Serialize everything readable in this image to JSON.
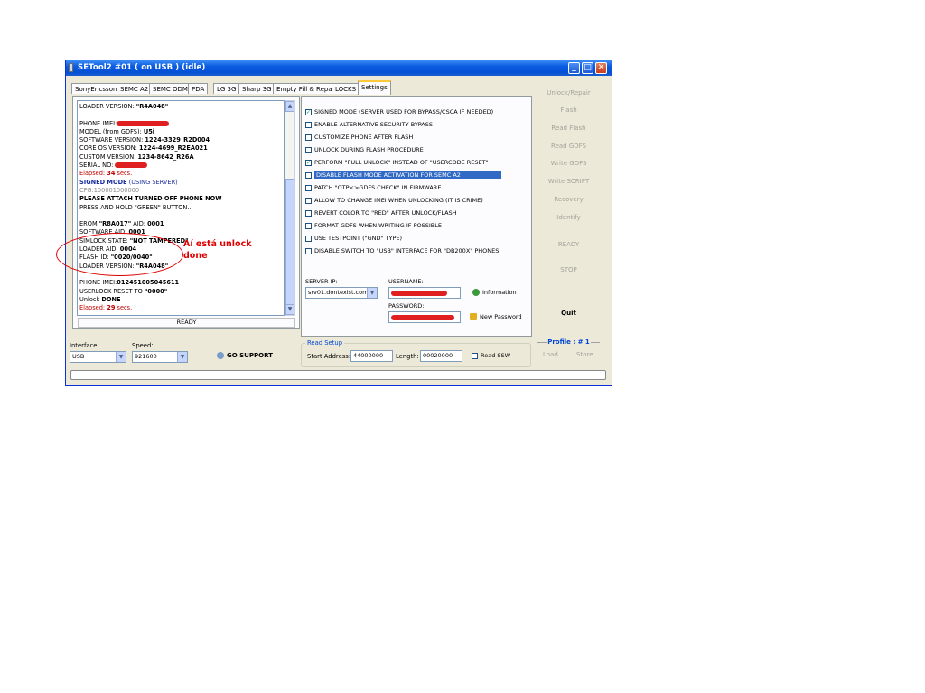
{
  "window": {
    "title": "SETool2 #01 ( on USB ) (idle)",
    "min": "_",
    "max": "□",
    "close": "✕"
  },
  "tabs": [
    {
      "label": "SonyEricsson"
    },
    {
      "label": "SEMC A2"
    },
    {
      "label": "SEMC ODM"
    },
    {
      "label": "PDA"
    },
    {
      "label": "LG 3G"
    },
    {
      "label": "Sharp 3G"
    },
    {
      "label": "Empty Fill & Repair"
    },
    {
      "label": "LOCKS"
    },
    {
      "label": "Settings",
      "active": true
    }
  ],
  "log": {
    "l01": "LOADER VERSION: ",
    "l01b": "\"R4A048\"",
    "l02": "PHONE IMEI:",
    "l03a": "MODEL (from GDFS): ",
    "l03b": "U5i",
    "l04a": "SOFTWARE VERSION: ",
    "l04b": "1224-3329_R2D004",
    "l05a": "CORE OS VERSION: ",
    "l05b": "1224-4699_R2EA021",
    "l06a": "CUSTOM VERSION: ",
    "l06b": "1234-8642_R26A",
    "l07": "SERIAL NO: ",
    "l08a": "Elapsed: ",
    "l08b": "34",
    "l08c": " secs.",
    "l09a": "SIGNED MODE",
    "l09b": " (USING SERVER)",
    "l10": "CFG:100001000000",
    "l11": "PLEASE ATTACH TURNED OFF PHONE NOW",
    "l12": "PRESS AND HOLD \"GREEN\" BUTTON...",
    "l13a": "EROM ",
    "l13b": "\"R8A017\"",
    "l13c": " AID: ",
    "l13d": "0001",
    "l14a": "SOFTWARE AID: ",
    "l14b": "0001",
    "l15a": "SIMLOCK STATE: ",
    "l15b": "\"NOT TAMPERED\"",
    "l16a": "LOADER AID: ",
    "l16b": "0004",
    "l17a": "FLASH ID: ",
    "l17b": "\"0020/0040\"",
    "l18a": "LOADER VERSION: ",
    "l18b": "\"R4A048\"",
    "l19a": "PHONE IMEI:",
    "l19b": "012451005045611",
    "l20a": "USERLOCK RESET TO ",
    "l20b": "\"0000\"",
    "l21a": "Unlock ",
    "l21b": "DONE",
    "l22a": "Elapsed: ",
    "l22b": "29",
    "l22c": " secs."
  },
  "status": "READY",
  "annotation": {
    "line1": "Aí está unlock",
    "line2": "done"
  },
  "settings": {
    "options": [
      {
        "label": "SIGNED MODE (SERVER USED FOR BYPASS/CSCA IF NEEDED)",
        "checked": true
      },
      {
        "label": "ENABLE ALTERNATIVE SECURITY BYPASS",
        "checked": false
      },
      {
        "label": "CUSTOMIZE PHONE AFTER FLASH",
        "checked": false
      },
      {
        "label": "UNLOCK DURING FLASH PROCEDURE",
        "checked": false
      },
      {
        "label": "PERFORM \"FULL UNLOCK\" INSTEAD OF \"USERCODE RESET\"",
        "checked": true
      },
      {
        "label": "DISABLE FLASH MODE ACTIVATION FOR SEMC A2",
        "checked": false,
        "highlighted": true
      },
      {
        "label": "PATCH \"OTP<>GDFS CHECK\" IN FIRMWARE",
        "checked": false
      },
      {
        "label": "ALLOW TO CHANGE IMEI WHEN UNLOCKING (IT IS CRIME)",
        "checked": false
      },
      {
        "label": "REVERT COLOR TO \"RED\" AFTER UNLOCK/FLASH",
        "checked": false
      },
      {
        "label": "FORMAT GDFS WHEN WRITING IF POSSIBLE",
        "checked": false
      },
      {
        "label": "USE TESTPOINT (\"GND\" TYPE)",
        "checked": false
      },
      {
        "label": "DISABLE SWITCH TO \"USB\" INTERFACE FOR \"DB200X\" PHONES",
        "checked": false
      }
    ],
    "server_ip_label": "SERVER IP:",
    "server_ip_value": "srv01.dontexist.com",
    "username_label": "USERNAME:",
    "password_label": "PASSWORD:",
    "information": "Information",
    "new_password": "New Password"
  },
  "right_buttons": {
    "unlock_repair": "Unlock/Repair",
    "flash": "Flash",
    "read_flash": "Read Flash",
    "read_gdfs": "Read GDFS",
    "write_gdfs": "Write GDFS",
    "write_script": "Write SCRIPT",
    "recovery": "Recovery",
    "identify": "Identify",
    "ready": "READY",
    "stop": "STOP",
    "quit": "Quit",
    "profile": "Profile : # 1",
    "load": "Load",
    "store": "Store"
  },
  "bottom": {
    "interface_label": "Interface:",
    "interface_value": "USB",
    "speed_label": "Speed:",
    "speed_value": "921600",
    "go_support": "GO SUPPORT",
    "read_setup": "Read Setup",
    "start_address_label": "Start Address:",
    "start_address_value": "44000000",
    "length_label": "Length:",
    "length_value": "00020000",
    "read_ssw": "Read SSW"
  },
  "colors": {
    "title_bar": "#0a5ae0",
    "annotation": "#e00000",
    "highlight": "#316ac5",
    "signed_mode": "#1c2fa0"
  }
}
